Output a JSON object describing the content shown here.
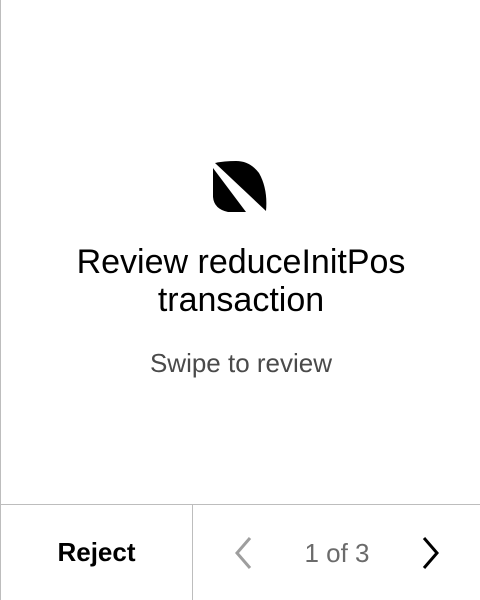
{
  "review": {
    "title_line1": "Review reduceInitPos",
    "title_line2": "transaction",
    "subtitle": "Swipe to review",
    "icon": "app-logo-icon"
  },
  "footer": {
    "reject_label": "Reject",
    "page_indicator": "1 of 3",
    "prev_icon": "chevron-left-icon",
    "next_icon": "chevron-right-icon"
  },
  "colors": {
    "background": "#ffffff",
    "text_primary": "#000000",
    "text_secondary": "#4a4a4a",
    "divider": "#bdbdbd",
    "nav_disabled": "#9e9e9e"
  }
}
